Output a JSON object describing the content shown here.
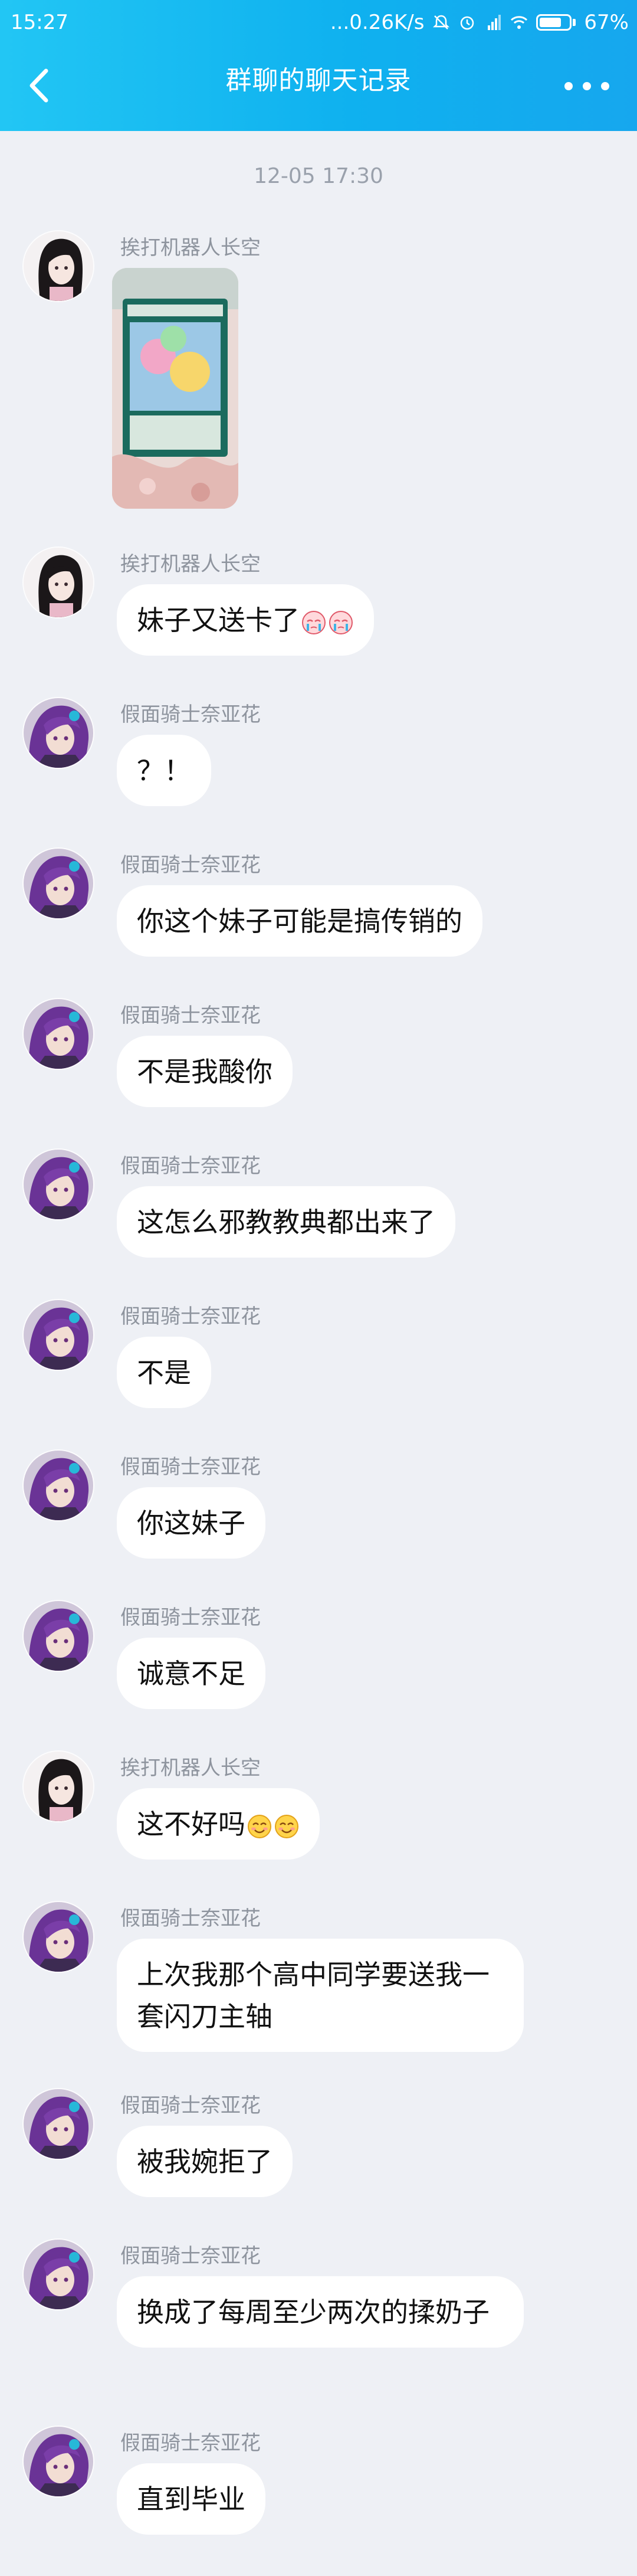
{
  "status_bar": {
    "time": "15:27",
    "net_speed": "...0.26K/s",
    "battery_percent": "67%"
  },
  "header": {
    "title": "群聊的聊天记录",
    "back_icon": "chevron-left-icon",
    "more_icon": "more-dots-icon"
  },
  "date_divider": "12-05 17:30",
  "senders": {
    "a": "挨打机器人长空",
    "b": "假面骑士奈亚花"
  },
  "messages": [
    {
      "sender": "挨打机器人长空",
      "type": "image"
    },
    {
      "sender": "挨打机器人长空",
      "text": "妹子又送卡了",
      "emoji": "crying-face-emoji"
    },
    {
      "sender": "假面骑士奈亚花",
      "text": "？！"
    },
    {
      "sender": "假面骑士奈亚花",
      "text": "你这个妹子可能是搞传销的"
    },
    {
      "sender": "假面骑士奈亚花",
      "text": "不是我酸你"
    },
    {
      "sender": "假面骑士奈亚花",
      "text": "这怎么邪教教典都出来了"
    },
    {
      "sender": "假面骑士奈亚花",
      "text": "不是"
    },
    {
      "sender": "假面骑士奈亚花",
      "text": "你这妹子"
    },
    {
      "sender": "假面骑士奈亚花",
      "text": "诚意不足"
    },
    {
      "sender": "挨打机器人长空",
      "text": "这不好吗",
      "emoji": "smiling-face-emoji"
    },
    {
      "sender": "假面骑士奈亚花",
      "text": "上次我那个高中同学要送我一套闪刀主轴"
    },
    {
      "sender": "假面骑士奈亚花",
      "text": "被我婉拒了"
    },
    {
      "sender": "假面骑士奈亚花",
      "text": "换成了每周至少两次的揉奶子"
    },
    {
      "sender": "假面骑士奈亚花",
      "text": "直到毕业"
    }
  ],
  "colors": {
    "header_gradient_start": "#22c6f4",
    "header_gradient_end": "#16a7ee",
    "background": "#eef0f5",
    "bubble": "#ffffff"
  }
}
